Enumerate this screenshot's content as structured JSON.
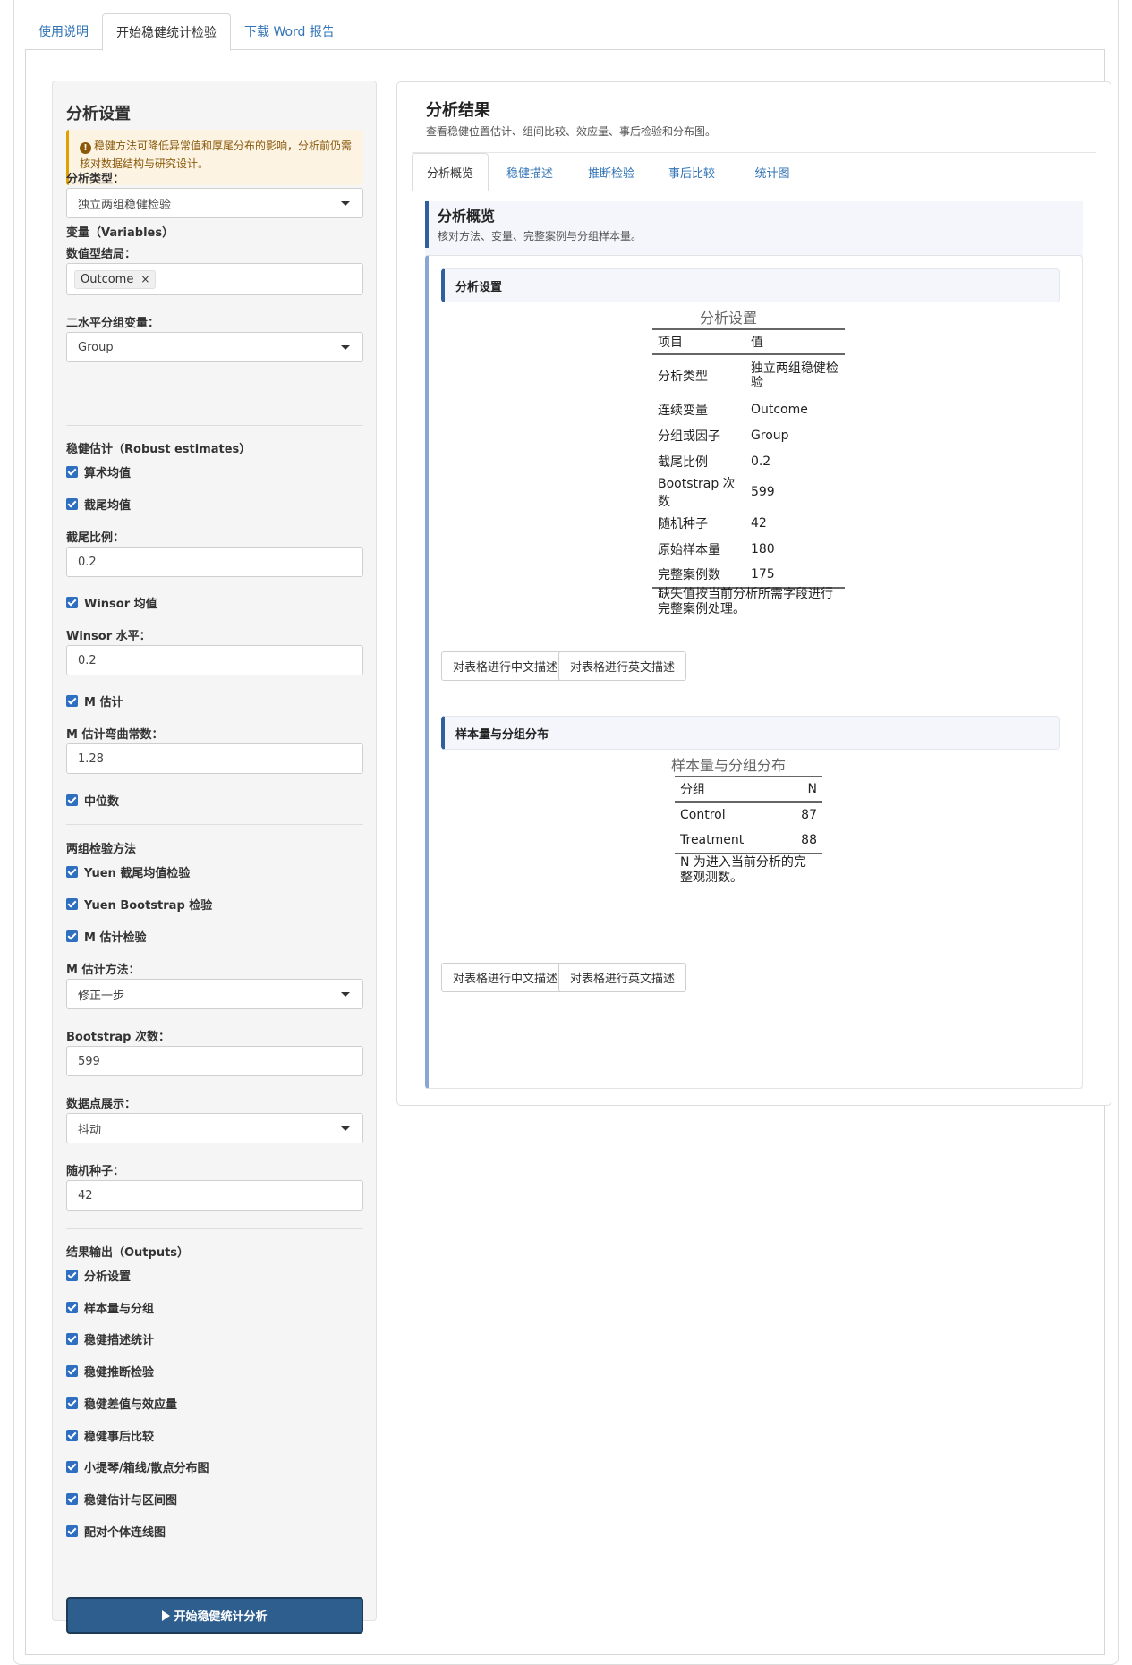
{
  "tabs": [
    "使用说明",
    "开始稳健统计检验",
    "下载 Word 报告"
  ],
  "sidebar": {
    "title": "分析设置",
    "warning": "稳健方法可降低异常值和厚尾分布的影响，分析前仍需核对数据结构与研究设计。",
    "analysis_type_label": "分析类型：",
    "analysis_type_value": "独立两组稳健检验",
    "variables_section": "变量（Variables）",
    "numeric_outcome_label": "数值型结局：",
    "numeric_outcome_chip": "Outcome",
    "chip_remove": "×",
    "group_label": "二水平分组变量：",
    "group_value": "Group",
    "robust_section": "稳健估计（Robust estimates）",
    "chk_mean": "算术均值",
    "chk_trimmed": "截尾均值",
    "trim_label": "截尾比例：",
    "trim_value": "0.2",
    "chk_winsor": "Winsor 均值",
    "winsor_label": "Winsor 水平：",
    "winsor_value": "0.2",
    "chk_m": "M 估计",
    "m_const_label": "M 估计弯曲常数：",
    "m_const_value": "1.28",
    "chk_median": "中位数",
    "twogroup_section": "两组检验方法",
    "chk_yuen": "Yuen 截尾均值检验",
    "chk_yuen_boot": "Yuen Bootstrap 检验",
    "chk_m_test": "M 估计检验",
    "m_method_label": "M 估计方法：",
    "m_method_value": "修正一步",
    "boot_label": "Bootstrap 次数：",
    "boot_value": "599",
    "points_label": "数据点展示：",
    "points_value": "抖动",
    "seed_label": "随机种子：",
    "seed_value": "42",
    "outputs_section": "结果输出（Outputs）",
    "outputs": [
      "分析设置",
      "样本量与分组",
      "稳健描述统计",
      "稳健推断检验",
      "稳健差值与效应量",
      "稳健事后比较",
      "小提琴/箱线/散点分布图",
      "稳健估计与区间图",
      "配对个体连线图"
    ],
    "run_button": "开始稳健统计分析"
  },
  "main": {
    "title": "分析结果",
    "subtitle": "查看稳健位置估计、组间比较、效应量、事后检验和分布图。",
    "tabs": [
      "分析概览",
      "稳健描述",
      "推断检验",
      "事后比较",
      "统计图"
    ],
    "overview_title": "分析概览",
    "overview_sub": "核对方法、变量、完整案例与分组样本量。",
    "card1": {
      "header": "分析设置",
      "table_title": "分析设置",
      "col1": "项目",
      "col2": "值",
      "rows": [
        [
          "分析类型",
          "独立两组稳健检验"
        ],
        [
          "连续变量",
          "Outcome"
        ],
        [
          "分组或因子",
          "Group"
        ],
        [
          "截尾比例",
          "0.2"
        ],
        [
          "Bootstrap 次数",
          "599"
        ],
        [
          "随机种子",
          "42"
        ],
        [
          "原始样本量",
          "180"
        ],
        [
          "完整案例数",
          "175"
        ]
      ],
      "note": "缺失值按当前分析所需字段进行完整案例处理。"
    },
    "card2": {
      "header": "样本量与分组分布",
      "table_title": "样本量与分组分布",
      "col1": "分组",
      "col2": "N",
      "rows": [
        [
          "Control",
          "87"
        ],
        [
          "Treatment",
          "88"
        ]
      ],
      "note": "N 为进入当前分析的完整观测数。"
    },
    "btn_cn": "对表格进行中文描述",
    "btn_en": "对表格进行英文描述"
  }
}
